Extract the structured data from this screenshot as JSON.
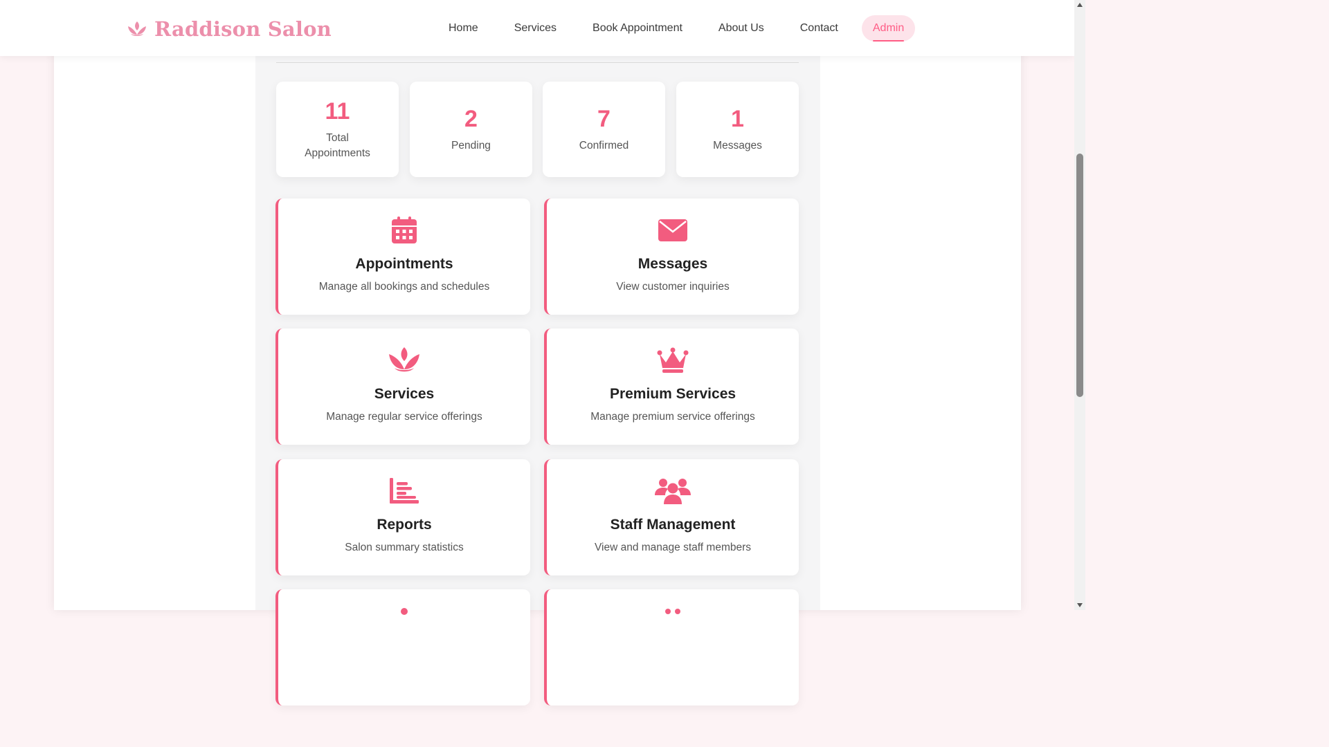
{
  "brand": {
    "name": "Raddison Salon",
    "icon": "lotus-icon",
    "color": "#ec8fab"
  },
  "nav": {
    "items": [
      {
        "label": "Home"
      },
      {
        "label": "Services"
      },
      {
        "label": "Book Appointment"
      },
      {
        "label": "About Us"
      },
      {
        "label": "Contact"
      },
      {
        "label": "Admin",
        "active": true
      }
    ]
  },
  "stats": [
    {
      "value": "11",
      "label": "Total Appointments"
    },
    {
      "value": "2",
      "label": "Pending"
    },
    {
      "value": "7",
      "label": "Confirmed"
    },
    {
      "value": "1",
      "label": "Messages"
    }
  ],
  "cards": [
    {
      "title": "Appointments",
      "desc": "Manage all bookings and schedules",
      "icon": "calendar-icon"
    },
    {
      "title": "Messages",
      "desc": "View customer inquiries",
      "icon": "envelope-icon"
    },
    {
      "title": "Services",
      "desc": "Manage regular service offerings",
      "icon": "lotus-icon"
    },
    {
      "title": "Premium Services",
      "desc": "Manage premium service offerings",
      "icon": "crown-icon"
    },
    {
      "title": "Reports",
      "desc": "Salon summary statistics",
      "icon": "bar-chart-icon"
    },
    {
      "title": "Staff Management",
      "desc": "View and manage staff members",
      "icon": "users-icon"
    }
  ],
  "theme": {
    "accent": "#f25c7f",
    "accent_soft": "#fde3ea",
    "background": "#fdf3f5"
  }
}
